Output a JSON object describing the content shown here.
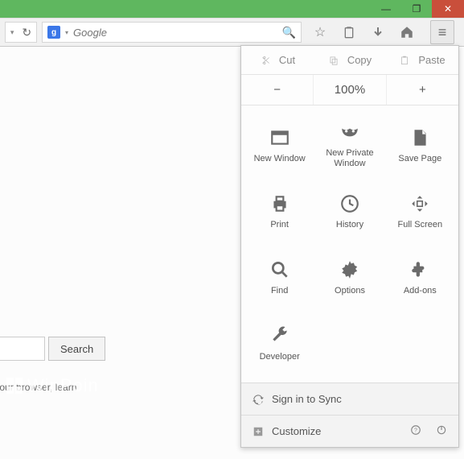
{
  "window": {
    "minimize": "—",
    "maximize": "❐",
    "close": "✕"
  },
  "toolbar": {
    "search_provider_glyph": "g",
    "search_placeholder": "Google",
    "dropdown_arrow": "▾",
    "reload_glyph": "↻",
    "search_glyph": "🔍",
    "star_glyph": "☆",
    "list_glyph": "📋",
    "download_glyph": "↓",
    "home_glyph": "⌂",
    "menu_glyph": "≡"
  },
  "page": {
    "search_button": "Search",
    "hint_text": "of your browser, learn",
    "watermark": "WinPoin"
  },
  "menu": {
    "edit": {
      "cut": "Cut",
      "copy": "Copy",
      "paste": "Paste"
    },
    "zoom": {
      "out": "−",
      "level": "100%",
      "in": "+"
    },
    "items": [
      {
        "label": "New Window"
      },
      {
        "label": "New Private\nWindow"
      },
      {
        "label": "Save Page"
      },
      {
        "label": "Print"
      },
      {
        "label": "History"
      },
      {
        "label": "Full Screen"
      },
      {
        "label": "Find"
      },
      {
        "label": "Options"
      },
      {
        "label": "Add-ons"
      },
      {
        "label": "Developer"
      }
    ],
    "sync_label": "Sign in to Sync",
    "customize_label": "Customize"
  }
}
